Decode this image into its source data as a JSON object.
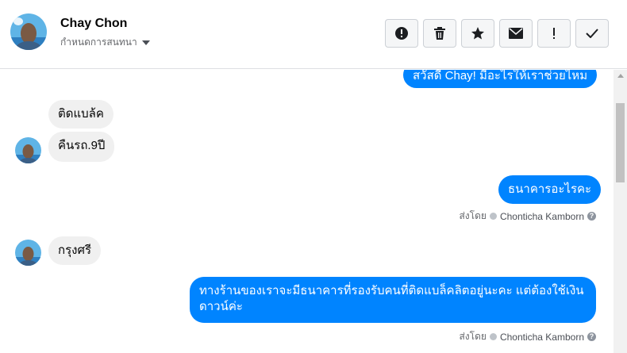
{
  "contact": {
    "name": "Chay Chon",
    "subtitle": "กำหนดการสนทนา"
  },
  "toolbar": {
    "icons": [
      "alert-circle-icon",
      "trash-icon",
      "star-icon",
      "envelope-icon",
      "exclamation-icon",
      "check-icon"
    ]
  },
  "messages": [
    {
      "from": "page",
      "text": "สวัสดี Chay! มีอะไรให้เราช่วยไหม"
    },
    {
      "from": "user",
      "text": "ติดแบล้ค"
    },
    {
      "from": "user",
      "text": "คืนรถ.9ปี"
    },
    {
      "from": "page",
      "text": "ธนาคารอะไรคะ",
      "sent_label": "ส่งโดย",
      "sent_by": "Chonticha Kamborn"
    },
    {
      "from": "user",
      "text": "กรุงศรี"
    },
    {
      "from": "page",
      "text_line1": "ทางร้านของเราจะมีธนาคารที่รองรับคนที่ติดแบล็คลิตอยู่นะคะ แต่ต้องใช้เงิน",
      "text_line2": "ดาวน์ค่ะ",
      "sent_label": "ส่งโดย",
      "sent_by": "Chonticha Kamborn"
    }
  ],
  "colors": {
    "accent": "#0084ff",
    "incoming": "#f0f0f0"
  }
}
